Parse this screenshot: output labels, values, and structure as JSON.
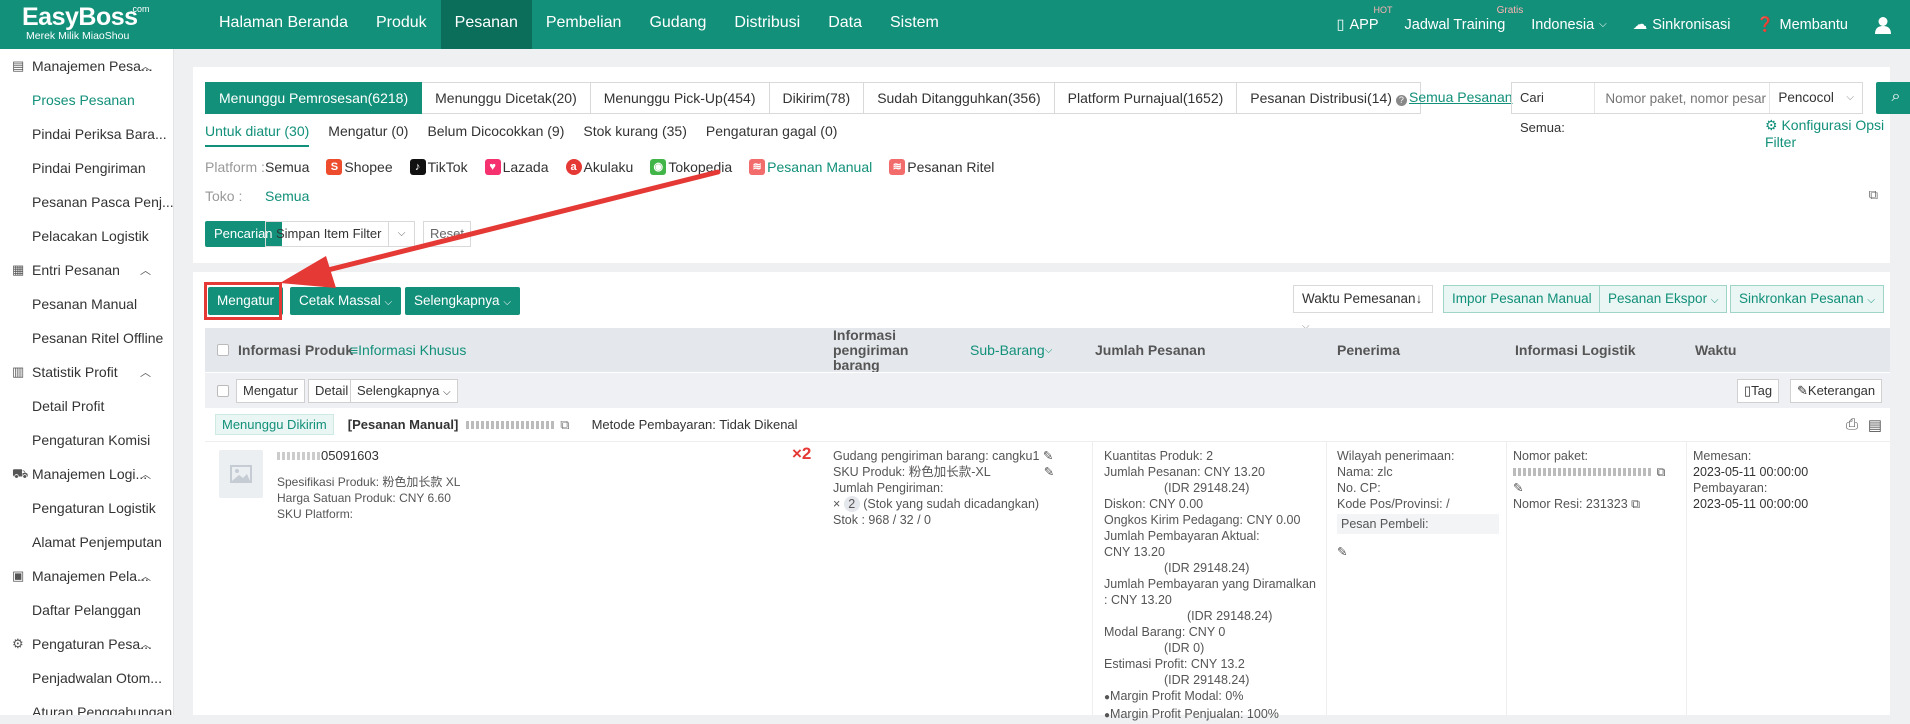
{
  "header": {
    "logo": {
      "brand": "EasyBoss",
      "com": ".com",
      "subtitle": "Merek Milik MiaoShou"
    },
    "nav": [
      {
        "label": "Halaman Beranda",
        "active": false
      },
      {
        "label": "Produk",
        "active": false
      },
      {
        "label": "Pesanan",
        "active": true
      },
      {
        "label": "Pembelian",
        "active": false
      },
      {
        "label": "Gudang",
        "active": false
      },
      {
        "label": "Distribusi",
        "active": false
      },
      {
        "label": "Data",
        "active": false
      },
      {
        "label": "Sistem",
        "active": false
      }
    ],
    "right": {
      "app": "APP",
      "app_badge": "HOT",
      "training": "Jadwal Training",
      "training_badge": "Gratis",
      "language": "Indonesia",
      "sync": "Sinkronisasi",
      "help": "Membantu"
    }
  },
  "sidebar": {
    "groups": [
      {
        "label": "Manajemen Pesa...",
        "items": [
          "Proses Pesanan",
          "Pindai Periksa Bara...",
          "Pindai Pengiriman",
          "Pesanan Pasca Penj...",
          "Pelacakan Logistik"
        ]
      },
      {
        "label": "Entri Pesanan",
        "items": [
          "Pesanan Manual",
          "Pesanan Ritel Offline"
        ]
      },
      {
        "label": "Statistik Profit",
        "items": [
          "Detail Profit",
          "Pengaturan Komisi"
        ]
      },
      {
        "label": "Manajemen Logi...",
        "items": [
          "Pengaturan Logistik",
          "Alamat Penjemputan"
        ]
      },
      {
        "label": "Manajemen Pela...",
        "items": [
          "Daftar Pelanggan"
        ]
      },
      {
        "label": "Pengaturan Pesa...",
        "items": [
          "Penjadwalan Otom...",
          "Aturan Penggabungan"
        ]
      }
    ],
    "active_item": "Proses Pesanan"
  },
  "filters": {
    "tabs": [
      {
        "label": "Menunggu Pemrosesan(6218)",
        "active": true
      },
      {
        "label": "Menunggu Dicetak(20)",
        "active": false
      },
      {
        "label": "Menunggu Pick-Up(454)",
        "active": false
      },
      {
        "label": "Dikirim(78)",
        "active": false
      },
      {
        "label": "Sudah Ditangguhkan(356)",
        "active": false
      },
      {
        "label": "Platform Purnajual(1652)",
        "active": false
      },
      {
        "label": "Pesanan Distribusi(14)",
        "active": false
      }
    ],
    "all_orders": "Semua Pesanan",
    "search_label": "Cari Semua:",
    "search_placeholder": "Nomor paket, nomor pesar",
    "search_mode": "Pencocol",
    "config_link": "Konfigurasi Opsi Filter",
    "subtabs": [
      {
        "label": "Untuk diatur (30)",
        "active": true
      },
      {
        "label": "Mengatur (0)",
        "active": false
      },
      {
        "label": "Belum Dicocokkan (9)",
        "active": false
      },
      {
        "label": "Stok kurang (35)",
        "active": false
      },
      {
        "label": "Pengaturan gagal (0)",
        "active": false
      }
    ],
    "platform_label": "Platform",
    "platforms": [
      "Semua",
      "Shopee",
      "TikTok",
      "Lazada",
      "Akulaku",
      "Tokopedia",
      "Pesanan Manual",
      "Pesanan Ritel"
    ],
    "platform_selected": "Pesanan Manual",
    "store_label": "Toko",
    "store_value": "Semua",
    "search_button": "Pencarian",
    "save_filter": "Simpan Item Filter",
    "reset": "Reset"
  },
  "toolbar": {
    "arrange": "Mengatur",
    "bulk_print": "Cetak Massal",
    "more": "Selengkapnya",
    "sort": "Waktu Pemesanan",
    "import_manual": "Impor Pesanan Manual",
    "export": "Pesanan Ekspor",
    "sync_orders": "Sinkronkan Pesanan"
  },
  "table": {
    "headers": {
      "product": "Informasi Produk",
      "special": "Informasi Khusus",
      "shipping": "Informasi pengiriman barang",
      "subitem": "Sub-Barang",
      "amount": "Jumlah Pesanan",
      "receiver": "Penerima",
      "logistics": "Informasi Logistik",
      "time": "Waktu"
    },
    "subbar": {
      "arrange": "Mengatur",
      "detail": "Detail",
      "more": "Selengkapnya",
      "tag": "Tag",
      "note": "Keterangan"
    },
    "order": {
      "status": "Menunggu Dikirim",
      "type": "[Pesanan Manual]",
      "payment": "Metode Pembayaran: Tidak Dikenal",
      "product": {
        "id_suffix": "05091603",
        "spec": "Spesifikasi Produk:  粉色加长款 XL",
        "unit_price": "Harga Satuan Produk:  CNY 6.60",
        "platform_sku": "SKU Platform:",
        "qty_mark": "×2"
      },
      "shipping": {
        "warehouse": "Gudang pengiriman barang:  cangku1",
        "sku": "SKU Produk:  粉色加长款-XL",
        "qty_label": "Jumlah Pengiriman:",
        "qty_value": "2",
        "qty_note": "(Stok yang sudah dicadangkan)",
        "stock": "Stok       :  968 / 32 / 0"
      },
      "amount": [
        "Kuantitas Produk:  2",
        "Jumlah Pesanan:  CNY 13.20",
        "(IDR 29148.24)",
        "Diskon:  CNY 0.00",
        "Ongkos Kirim Pedagang:  CNY 0.00",
        "Jumlah Pembayaran Aktual:",
        "CNY 13.20",
        "(IDR 29148.24)",
        "Jumlah Pembayaran yang Diramalkan",
        ":  CNY 13.20",
        "(IDR 29148.24)",
        "Modal Barang:  CNY 0",
        "(IDR 0)",
        "Estimasi Profit:  CNY 13.2",
        "(IDR 29148.24)",
        "Margin Profit Modal:  0%",
        "Margin Profit Penjualan:  100%"
      ],
      "receiver": {
        "region": "Wilayah penerimaan:",
        "name": "Nama:  zlc",
        "phone": "No. CP:",
        "postal": "Kode Pos/Provinsi:  /",
        "buyer_msg": "Pesan Pembeli:"
      },
      "logistics": {
        "package": "Nomor paket:",
        "resi": "Nomor Resi:  231323"
      },
      "time": {
        "ordered_label": "Memesan:",
        "ordered": "2023-05-11 00:00:00",
        "paid_label": "Pembayaran:",
        "paid": "2023-05-11 00:00:00"
      }
    }
  },
  "colors": {
    "brand": "#12907a",
    "annotation": "#e53935"
  }
}
